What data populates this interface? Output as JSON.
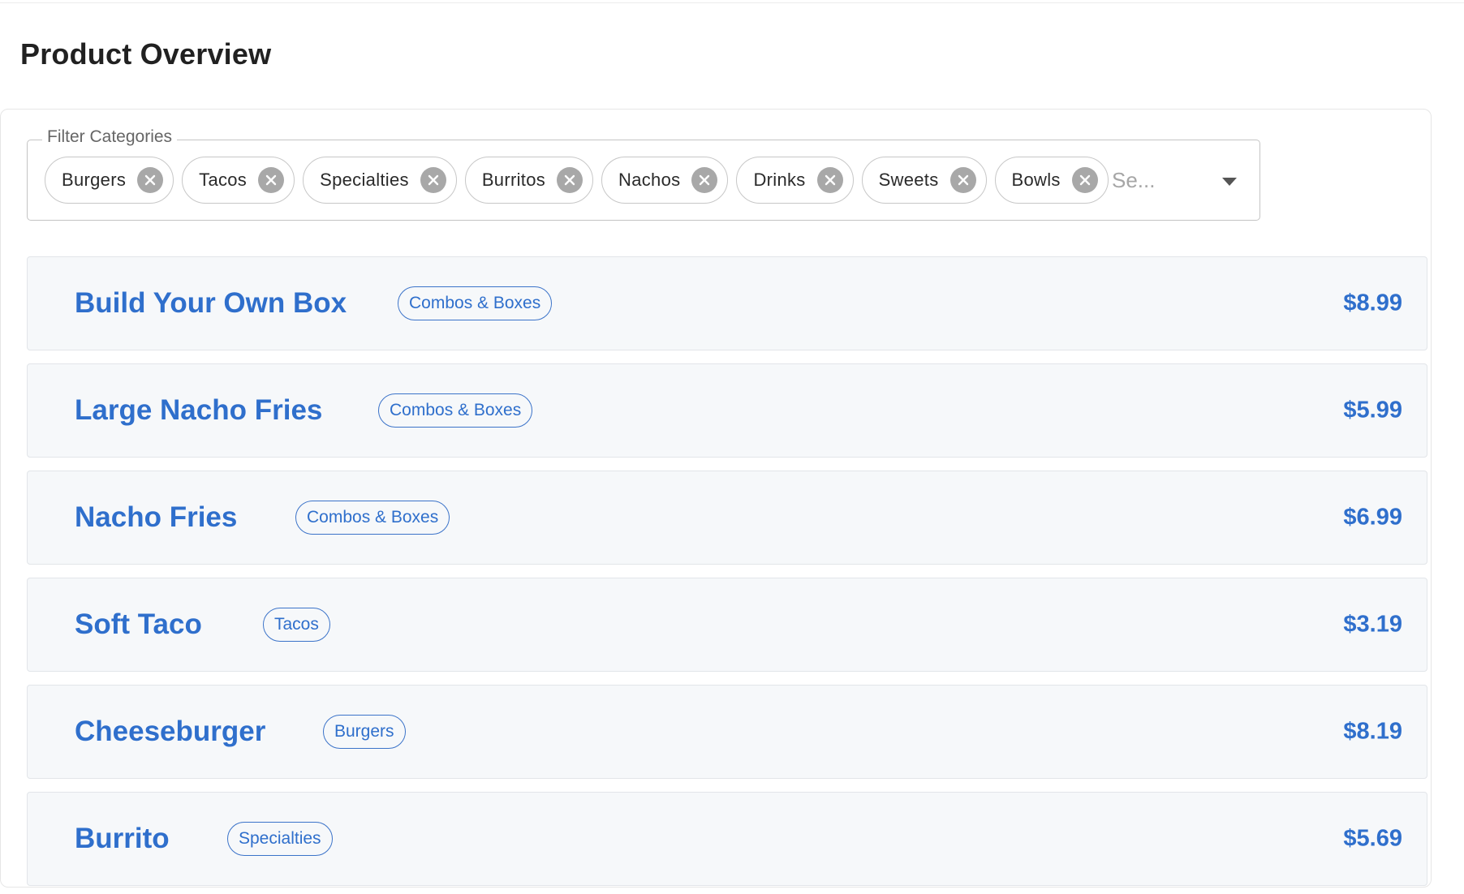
{
  "page": {
    "title": "Product Overview"
  },
  "filter": {
    "legend": "Filter Categories",
    "chips": [
      {
        "label": "Burgers",
        "name": "burgers"
      },
      {
        "label": "Tacos",
        "name": "tacos"
      },
      {
        "label": "Specialties",
        "name": "specialties"
      },
      {
        "label": "Burritos",
        "name": "burritos"
      },
      {
        "label": "Nachos",
        "name": "nachos"
      },
      {
        "label": "Drinks",
        "name": "drinks"
      },
      {
        "label": "Sweets",
        "name": "sweets"
      },
      {
        "label": "Bowls",
        "name": "bowls"
      }
    ],
    "search_placeholder": "Se...",
    "remove_icon": "close-circle-icon",
    "dropdown_icon": "caret-down-icon"
  },
  "products": [
    {
      "name": "Build Your Own Box",
      "category": "Combos & Boxes",
      "price": "$8.99"
    },
    {
      "name": "Large Nacho Fries",
      "category": "Combos & Boxes",
      "price": "$5.99"
    },
    {
      "name": "Nacho Fries",
      "category": "Combos & Boxes",
      "price": "$6.99"
    },
    {
      "name": "Soft Taco",
      "category": "Tacos",
      "price": "$3.19"
    },
    {
      "name": "Cheeseburger",
      "category": "Burgers",
      "price": "$8.19"
    },
    {
      "name": "Burrito",
      "category": "Specialties",
      "price": "$5.69"
    }
  ],
  "colors": {
    "accent": "#2f6fcc",
    "row_background": "#f6f8fa",
    "chip_border": "#c7c7c7",
    "chip_remove": "#a8a8a8"
  }
}
